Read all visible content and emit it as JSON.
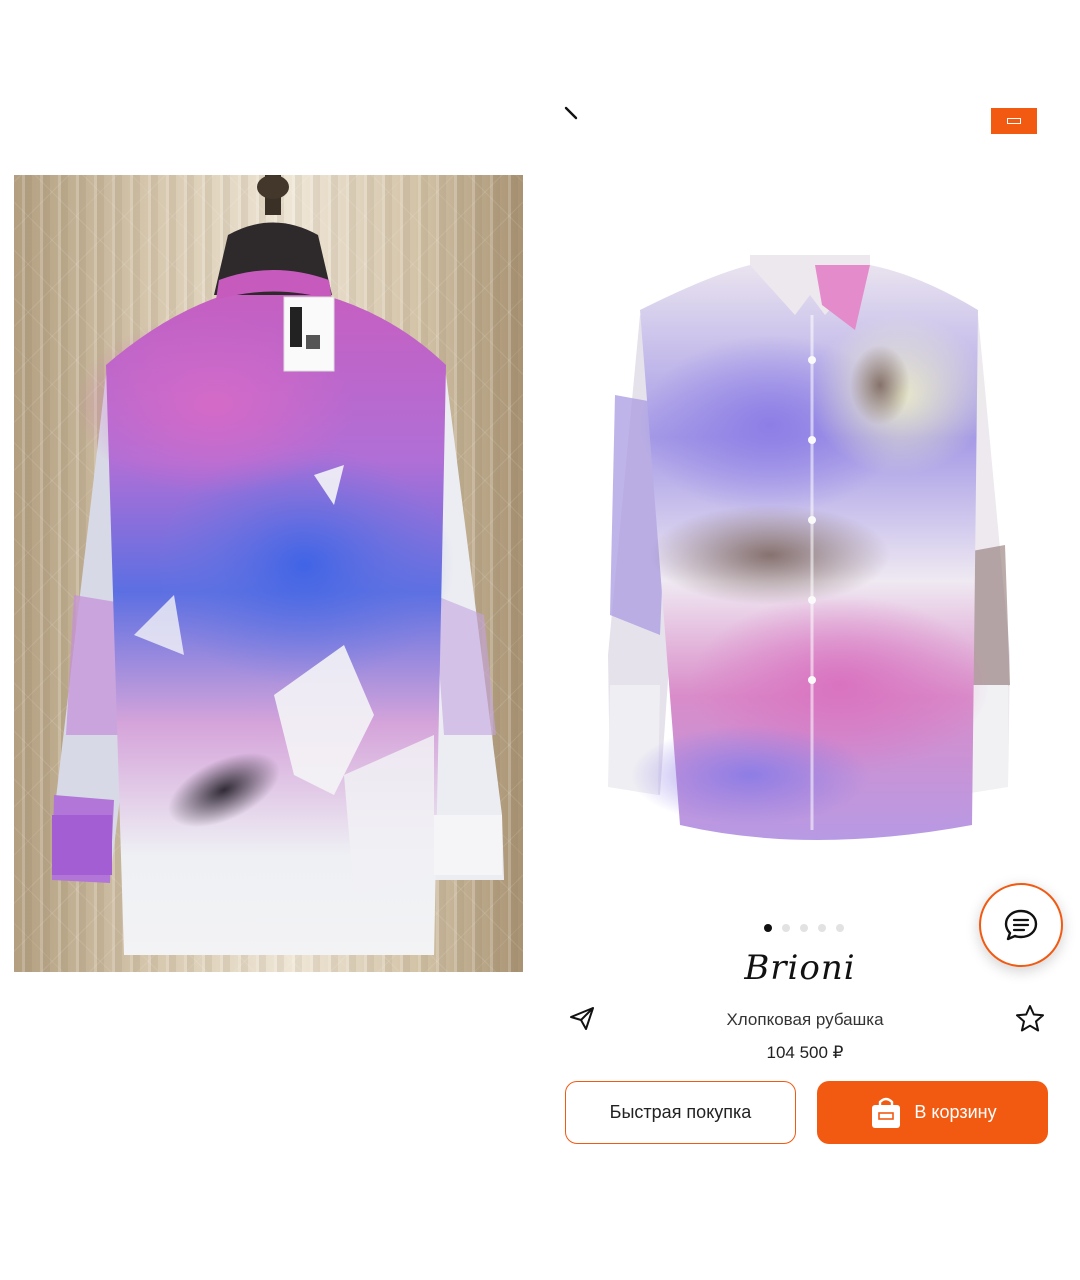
{
  "product": {
    "brand": "Brioni",
    "title": "Хлопковая рубашка",
    "price": "104 500 ₽",
    "image_count": 5,
    "active_image": 1
  },
  "actions": {
    "quick_buy_label": "Быстрая покупка",
    "add_to_cart_label": "В корзину"
  },
  "icons": {
    "back": "chevron-left-icon",
    "share": "send-icon",
    "favorite": "star-outline-icon",
    "chat": "chat-bubble-icon",
    "cart": "shopping-bag-icon"
  },
  "colors": {
    "accent": "#f25a12",
    "text": "#222222",
    "dot_active": "#111111",
    "dot_inactive": "#e2e2e2"
  }
}
